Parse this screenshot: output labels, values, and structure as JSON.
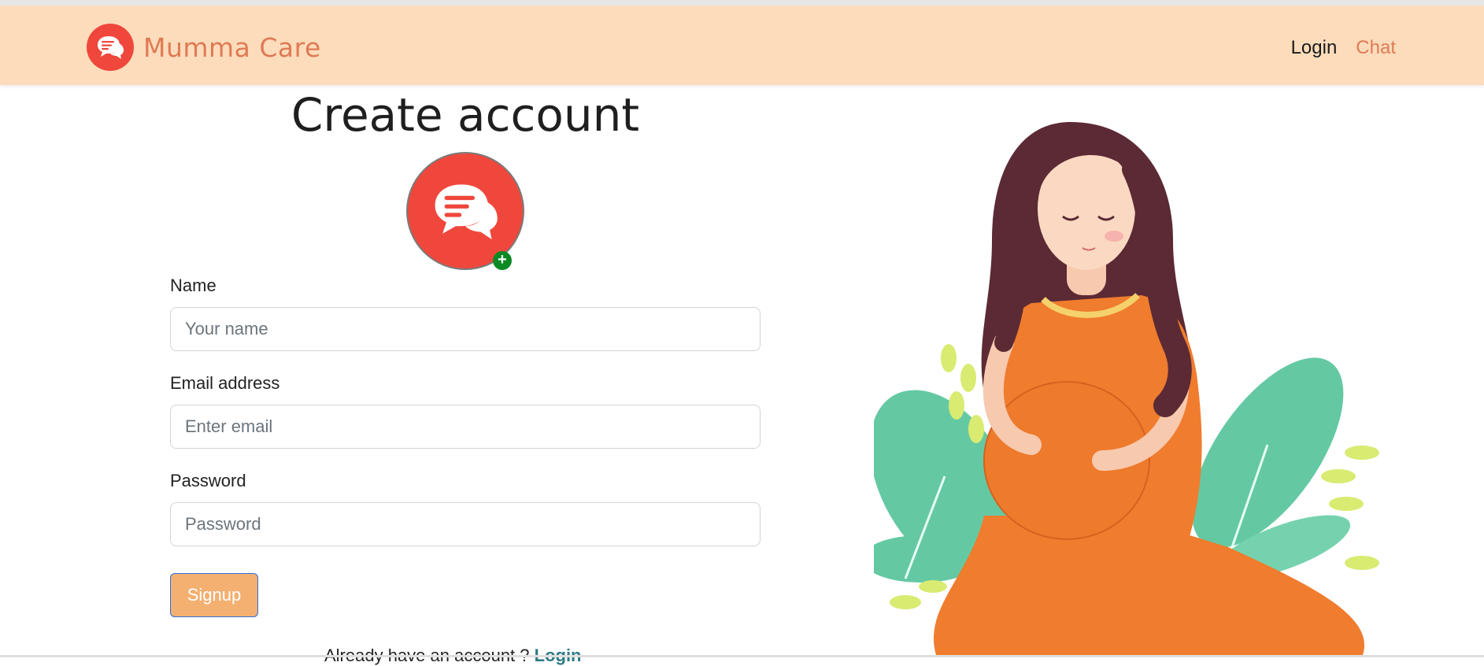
{
  "navbar": {
    "brand_name": "Mumma Care",
    "links": [
      {
        "label": "Login"
      },
      {
        "label": "Chat"
      }
    ]
  },
  "page": {
    "title": "Create account"
  },
  "form": {
    "name": {
      "label": "Name",
      "placeholder": "Your name",
      "value": ""
    },
    "email": {
      "label": "Email address",
      "placeholder": "Enter email",
      "value": ""
    },
    "password": {
      "label": "Password",
      "placeholder": "Password",
      "value": ""
    },
    "submit_label": "Signup",
    "avatar_add_symbol": "+"
  },
  "footer_prompt": {
    "text": "Already have an account ? ",
    "link": "Login"
  },
  "icons": {
    "brand": "chat-bubbles-icon",
    "avatar": "chat-bubbles-icon",
    "add": "plus-icon"
  },
  "colors": {
    "navbar_bg": "#fcdcbb",
    "brand_text": "#e07a55",
    "logo_red": "#f0473c",
    "signup_bg": "#f4b071",
    "add_badge": "#0b8a23",
    "link_teal": "#2c7a86"
  }
}
